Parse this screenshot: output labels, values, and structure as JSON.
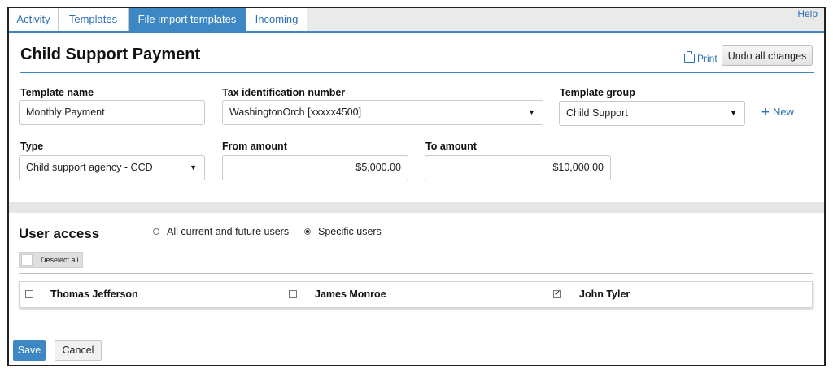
{
  "tabs": [
    {
      "label": "Activity",
      "active": false
    },
    {
      "label": "Templates",
      "active": false
    },
    {
      "label": "File import templates",
      "active": true
    },
    {
      "label": "Incoming",
      "active": false
    }
  ],
  "help_label": "Help",
  "page_title": "Child Support Payment",
  "print_label": "Print",
  "undo_label": "Undo all changes",
  "form": {
    "template_name": {
      "label": "Template name",
      "value": "Monthly Payment"
    },
    "tax_id": {
      "label": "Tax identification number",
      "value": "WashingtonOrch [xxxxx4500]"
    },
    "template_group": {
      "label": "Template group",
      "value": "Child Support"
    },
    "new_label": "New",
    "type": {
      "label": "Type",
      "value": "Child support agency - CCD"
    },
    "from_amount": {
      "label": "From amount",
      "value": "$5,000.00"
    },
    "to_amount": {
      "label": "To amount",
      "value": "$10,000.00"
    }
  },
  "user_access": {
    "title": "User access",
    "options": [
      {
        "label": "All current and future users",
        "checked": false
      },
      {
        "label": "Specific users",
        "checked": true
      }
    ],
    "deselect_label": "Deselect all",
    "users": [
      {
        "name": "Thomas Jefferson",
        "checked": false
      },
      {
        "name": "James Monroe",
        "checked": false
      },
      {
        "name": "John Tyler",
        "checked": true
      }
    ]
  },
  "actions": {
    "save_label": "Save",
    "cancel_label": "Cancel"
  },
  "colors": {
    "accent": "#3d87c4",
    "link": "#2c6fb3"
  },
  "icons": [
    "printer-icon",
    "plus-icon",
    "dropdown-caret-icon",
    "checkbox-icon",
    "radio-icon"
  ]
}
